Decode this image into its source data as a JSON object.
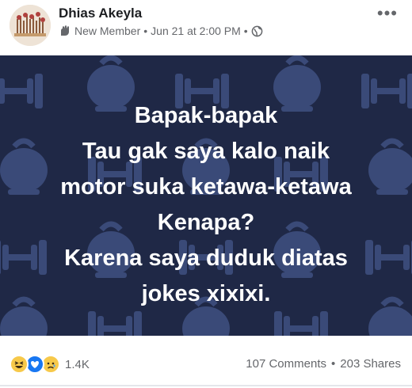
{
  "post": {
    "author": "Dhias Akeyla",
    "badge": "New Member",
    "date": "Jun 21 at 2:00 PM",
    "privacy_icon": "globe-icon",
    "text_lines": [
      "Bapak-bapak",
      "Tau gak saya kalo naik",
      "motor suka ketawa-ketawa",
      "Kenapa?",
      "Karena saya duduk diatas",
      "jokes xixixi."
    ],
    "background_color": "#1f2846",
    "pattern_color": "#3a4a78"
  },
  "engagement": {
    "reactions": [
      "haha-icon",
      "love-icon",
      "sad-icon"
    ],
    "reaction_count": "1.4K",
    "comments": "107 Comments",
    "shares": "203 Shares",
    "separator": "•"
  },
  "header": {
    "meta_separator": "•"
  }
}
